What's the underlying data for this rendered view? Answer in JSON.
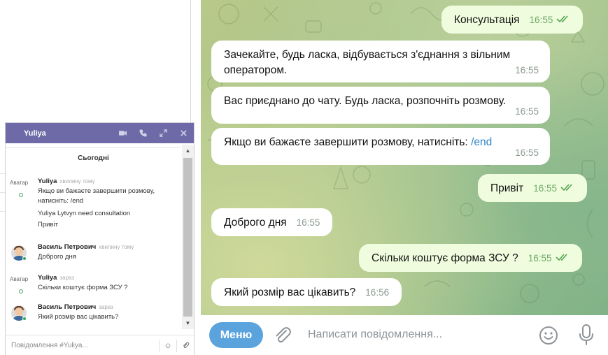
{
  "widget": {
    "agent_name": "Yuliya",
    "day_label": "Сьогодні",
    "input_placeholder": "Повідомлення #Yuliya...",
    "messages": [
      {
        "sender": "Yuliya",
        "time": "хвилину тому",
        "avatar_alt": "Аватар",
        "lines": [
          "Якщо ви бажаєте завершити розмову, натисніть: /end",
          "Yuliya Lytvyn need consultation",
          "Привіт"
        ]
      },
      {
        "sender": "Василь Петрович",
        "time": "хвилину тому",
        "lines": [
          "Доброго дня"
        ]
      },
      {
        "sender": "Yuliya",
        "time": "зараз",
        "avatar_alt": "Аватар",
        "lines": [
          "Скільки коштує форма ЗСУ ?"
        ]
      },
      {
        "sender": "Василь Петрович",
        "time": "зараз",
        "lines": [
          "Який розмір вас цікавить?"
        ]
      }
    ]
  },
  "telegram": {
    "messages": [
      {
        "direction": "out",
        "text": "Консультація",
        "time": "16:55",
        "read": true
      },
      {
        "direction": "in",
        "text": "Зачекайте, будь ласка, відбувається з'єднання з вільним оператором.",
        "time": "16:55"
      },
      {
        "direction": "in",
        "text": "Вас приєднано до чату.  Будь ласка, розпочніть розмову.",
        "time": "16:55"
      },
      {
        "direction": "in",
        "text": "Якщо ви бажаєте завершити розмову, натисніть: ",
        "command": "/end",
        "time": "16:55"
      },
      {
        "direction": "out",
        "text": "Привіт",
        "time": "16:55",
        "read": true
      },
      {
        "direction": "in",
        "text": "Доброго дня",
        "time": "16:55"
      },
      {
        "direction": "out",
        "text": "Скільки коштує  форма ЗСУ ?",
        "time": "16:55",
        "read": true
      },
      {
        "direction": "in",
        "text": "Який розмір вас цікавить?",
        "time": "16:56"
      }
    ],
    "menu_label": "Меню",
    "input_placeholder": "Написати повідомлення..."
  },
  "colors": {
    "widget_header": "#6e6aa7",
    "outgoing_bubble": "#effdde",
    "menu_button": "#5aa3dd",
    "command_link": "#2f84c6"
  },
  "icons": [
    "video-icon",
    "phone-icon",
    "expand-icon",
    "close-icon",
    "smile-icon",
    "attach-icon",
    "paperclip-icon",
    "emoji-icon",
    "microphone-icon"
  ]
}
